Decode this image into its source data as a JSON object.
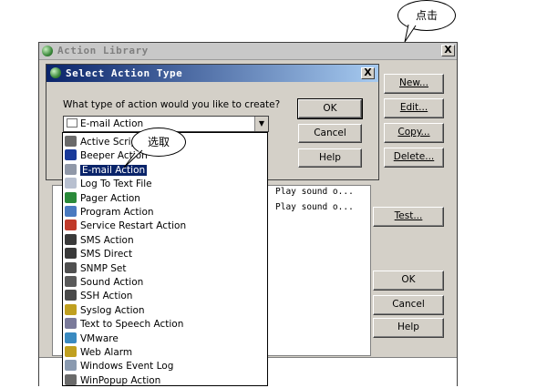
{
  "callouts": {
    "click": "点击",
    "select": "选取"
  },
  "library_window": {
    "title": "Action Library",
    "close_label": "X",
    "buttons": {
      "new": "New...",
      "edit": "Edit...",
      "copy": "Copy...",
      "delete": "Delete...",
      "test": "Test...",
      "ok": "OK",
      "cancel": "Cancel",
      "help": "Help"
    },
    "list_lines": [
      "Play sound o...",
      "Play sound o..."
    ]
  },
  "dialog": {
    "title": "Select Action Type",
    "close_label": "X",
    "prompt": "What type of action would you like to create?",
    "combo_value": "E-mail Action",
    "buttons": {
      "ok": "OK",
      "cancel": "Cancel",
      "help": "Help"
    }
  },
  "dropdown": {
    "items": [
      {
        "label": "Active Scrip",
        "icon": "script-icon",
        "color": "#6a6a6a"
      },
      {
        "label": "Beeper Action",
        "icon": "beeper-icon",
        "color": "#1a3a9a"
      },
      {
        "label": "E-mail Action",
        "icon": "email-icon",
        "color": "#9098a8",
        "selected": true
      },
      {
        "label": "Log To Text File",
        "icon": "log-file-icon",
        "color": "#b8c0d0"
      },
      {
        "label": "Pager Action",
        "icon": "pager-icon",
        "color": "#2a8a3a"
      },
      {
        "label": "Program Action",
        "icon": "program-icon",
        "color": "#4a7ac0"
      },
      {
        "label": "Service Restart Action",
        "icon": "service-restart-icon",
        "color": "#c03a2a"
      },
      {
        "label": "SMS Action",
        "icon": "sms-icon",
        "color": "#3a3a3a"
      },
      {
        "label": "SMS Direct",
        "icon": "sms-direct-icon",
        "color": "#3a3a3a"
      },
      {
        "label": "SNMP Set",
        "icon": "snmp-icon",
        "color": "#505050"
      },
      {
        "label": "Sound Action",
        "icon": "sound-icon",
        "color": "#5a5a5a"
      },
      {
        "label": "SSH Action",
        "icon": "ssh-icon",
        "color": "#4a4a4a"
      },
      {
        "label": "Syslog Action",
        "icon": "syslog-icon",
        "color": "#c0a020"
      },
      {
        "label": "Text to Speech Action",
        "icon": "tts-icon",
        "color": "#7a7a9a"
      },
      {
        "label": "VMware",
        "icon": "vmware-icon",
        "color": "#3a8ac0"
      },
      {
        "label": "Web Alarm",
        "icon": "web-alarm-icon",
        "color": "#c0a020"
      },
      {
        "label": "Windows Event Log",
        "icon": "event-log-icon",
        "color": "#8a9ab0"
      },
      {
        "label": "WinPopup Action",
        "icon": "winpopup-icon",
        "color": "#6a6a6a"
      }
    ]
  }
}
